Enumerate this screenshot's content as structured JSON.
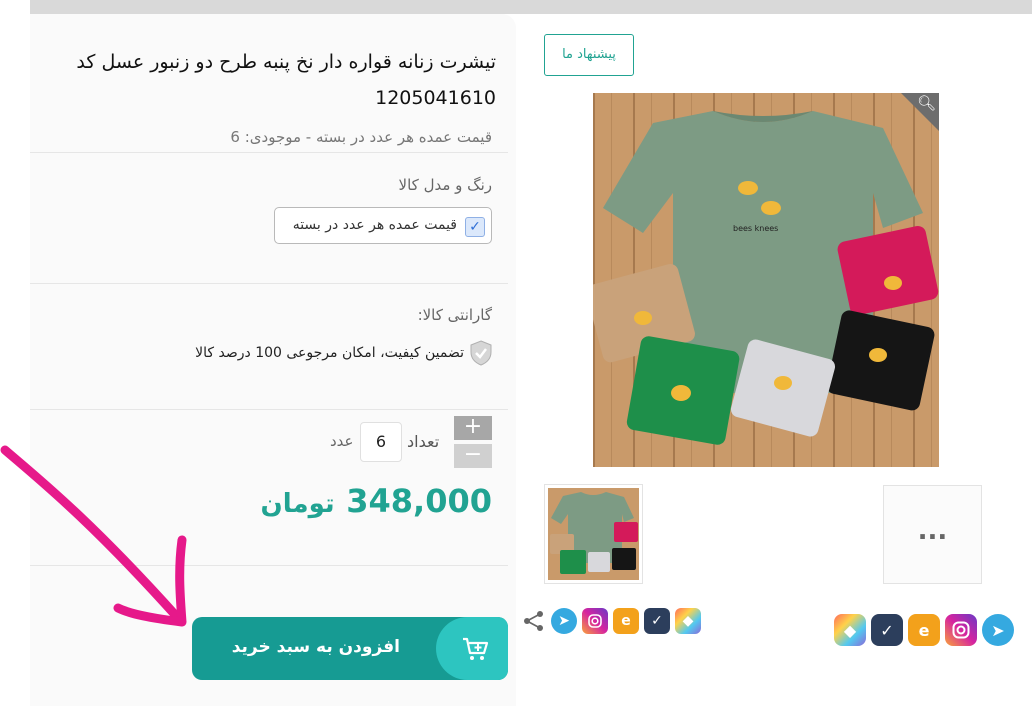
{
  "product": {
    "title_line1": "تیشرت زنانه قواره دار نخ پنبه طرح دو زنبور عسل کد",
    "title_line2": "1205041610",
    "stock_text": "قیمت عمده هر عدد در بسته - موجودی: 6"
  },
  "attributes": {
    "title": "رنگ و مدل کالا",
    "option_label": "قیمت عمده هر عدد در بسته"
  },
  "guarantee": {
    "title": "گارانتی کالا:",
    "text": "تضمین کیفیت، امکان مرجوعی 100 درصد کالا"
  },
  "quantity": {
    "label": "تعداد",
    "value": "6",
    "unit": "عدد",
    "plus": "+",
    "minus": "−"
  },
  "price": {
    "amount": "348,000",
    "currency": "تومان"
  },
  "cart": {
    "add_label": "افزودن به سبد خرید"
  },
  "suggest_label": "پیشنهاد ما",
  "gallery": {
    "more_label": "...",
    "print_text": "bees knees"
  },
  "colors": {
    "accent": "#21a392",
    "button": "#169b93",
    "button_icon_bg": "#2dc5c0",
    "annotation_arrow": "#e6198a"
  }
}
